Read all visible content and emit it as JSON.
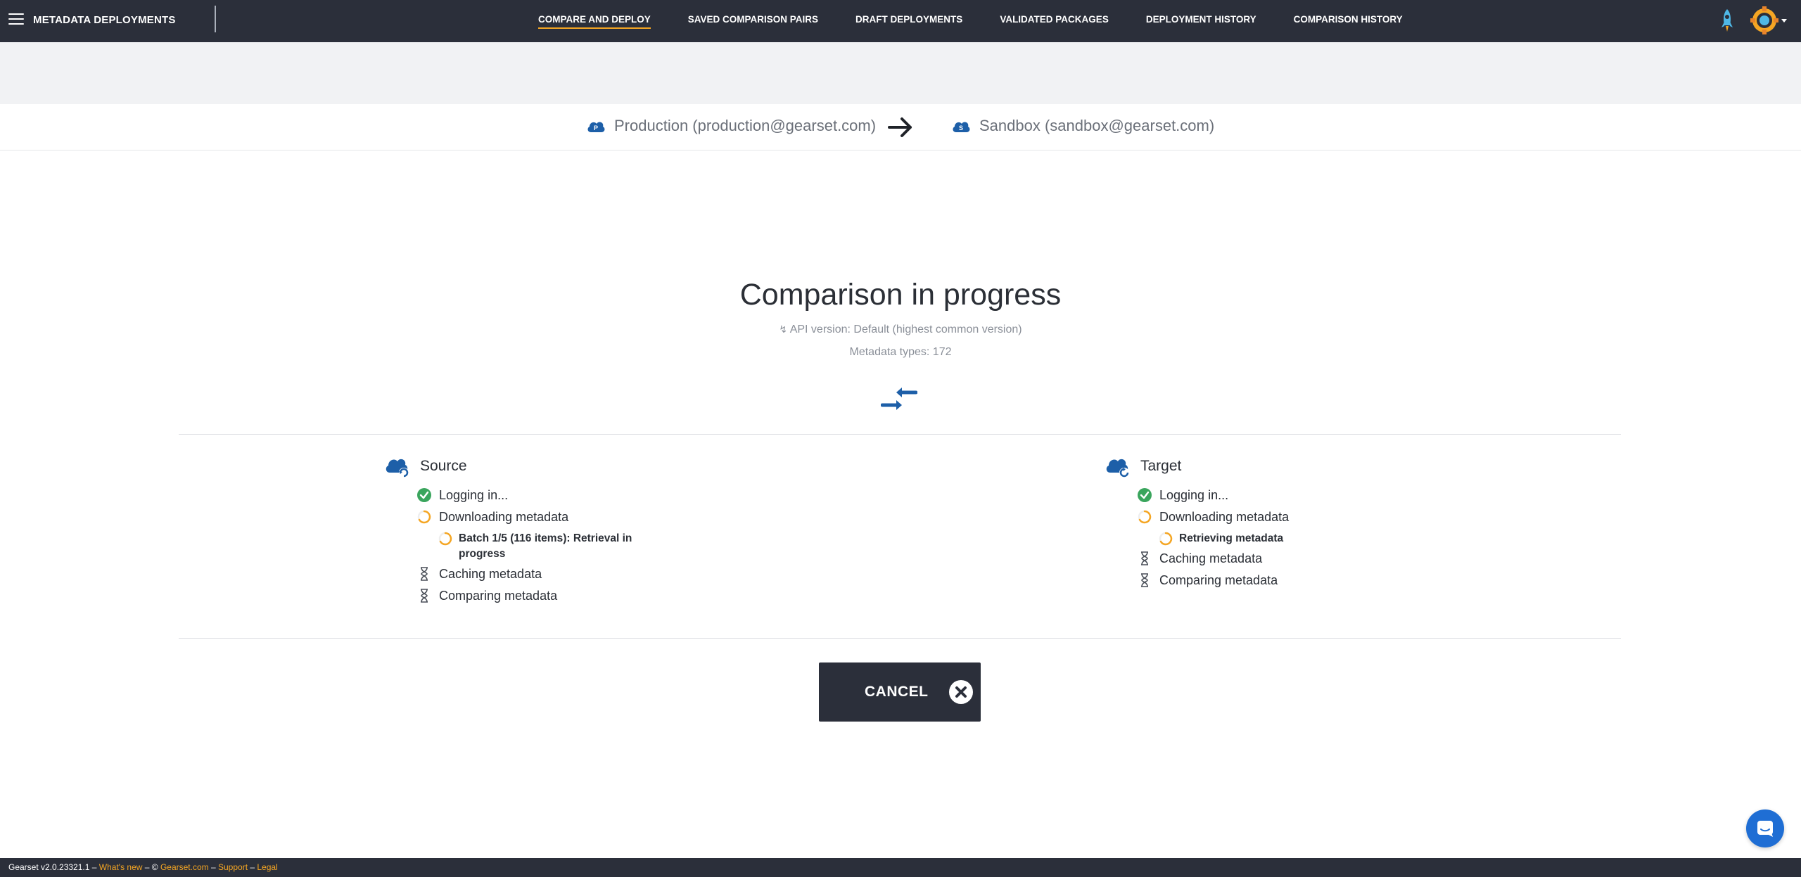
{
  "app": {
    "title": "METADATA DEPLOYMENTS"
  },
  "nav": {
    "items": [
      {
        "label": "COMPARE AND DEPLOY",
        "active": true
      },
      {
        "label": "SAVED COMPARISON PAIRS"
      },
      {
        "label": "DRAFT DEPLOYMENTS"
      },
      {
        "label": "VALIDATED PACKAGES"
      },
      {
        "label": "DEPLOYMENT HISTORY"
      },
      {
        "label": "COMPARISON HISTORY"
      }
    ]
  },
  "pair": {
    "source": {
      "badge": "P",
      "label": "Production (production@gearset.com)"
    },
    "target": {
      "badge": "S",
      "label": "Sandbox (sandbox@gearset.com)"
    }
  },
  "progress": {
    "title": "Comparison in progress",
    "api_version": "API version: Default (highest common version)",
    "metadata_types": "Metadata types: 172"
  },
  "source": {
    "heading": "Source",
    "steps": {
      "login": "Logging in...",
      "download": "Downloading metadata",
      "download_sub": "Batch 1/5 (116 items): Retrieval in progress",
      "cache": "Caching metadata",
      "compare": "Comparing metadata"
    }
  },
  "target": {
    "heading": "Target",
    "steps": {
      "login": "Logging in...",
      "download": "Downloading metadata",
      "download_sub": "Retrieving metadata",
      "cache": "Caching metadata",
      "compare": "Comparing metadata"
    }
  },
  "cancel_label": "CANCEL",
  "footer": {
    "version": "Gearset v2.0.23321.1",
    "sep1": " – ",
    "whats_new": "What's new",
    "sep2": " – © ",
    "gearset": "Gearset.com",
    "sep3": " – ",
    "support": "Support",
    "sep4": " – ",
    "legal": "Legal"
  },
  "colors": {
    "nav_bg": "#2b2f3a",
    "accent": "#f5a623",
    "brand_blue": "#1d5fa8",
    "success": "#3aa55d"
  }
}
